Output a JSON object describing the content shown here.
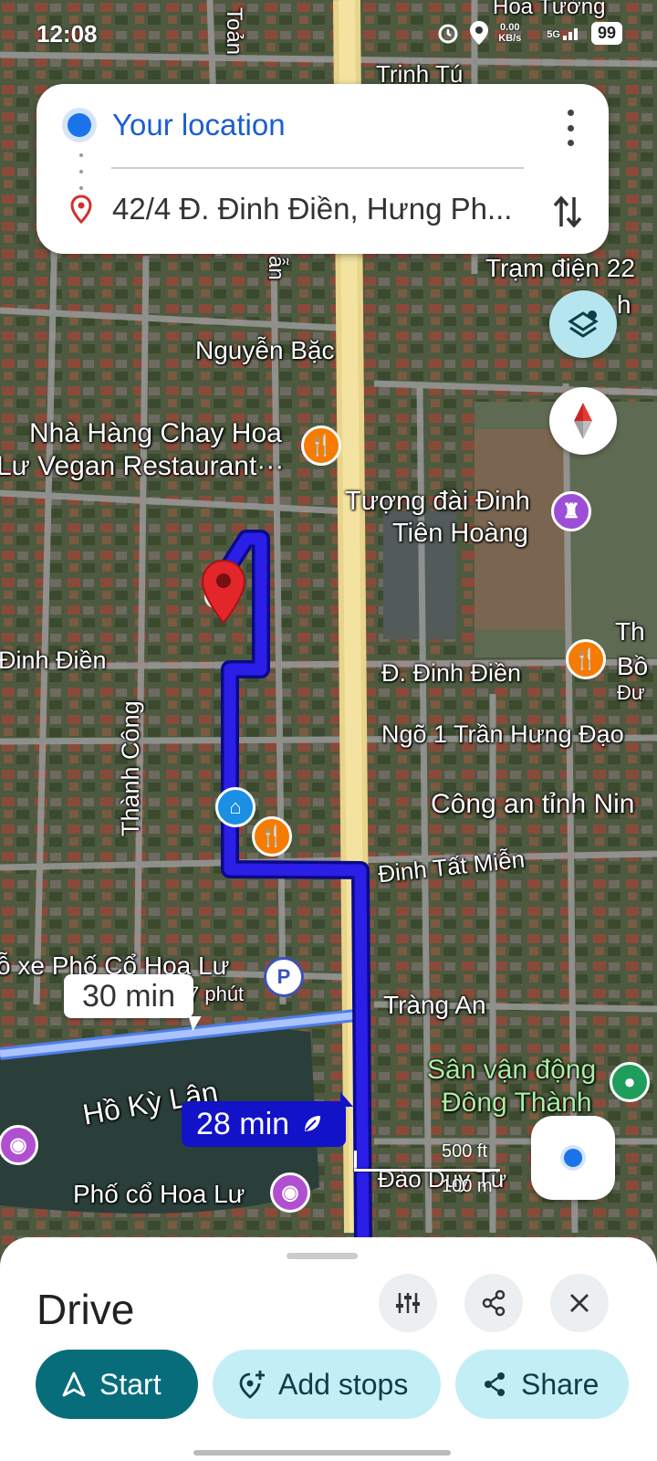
{
  "status_bar": {
    "time": "12:08",
    "network_speed": "0.00\nKB/s",
    "network_type": "5G",
    "battery": "99"
  },
  "directions": {
    "origin": "Your location",
    "destination": "42/4 Đ. Đinh Điền, Hưng Ph..."
  },
  "map": {
    "labels": {
      "trinh_tu": "Trịnh Tú",
      "toan": "Toản",
      "an": "ẫn",
      "tram_dien": "Trạm điện 22",
      "tram_dien_2": "h",
      "nguyen_bac": "Nguyễn Bặc",
      "restaurant_1": "Nhà Hàng Chay Hoa",
      "restaurant_2": "Lư Vegan Restaurant···",
      "statue_1": "Tượng đài Đinh",
      "statue_2": "Tiên Hoàng",
      "dinh_dien_left": "Đinh Điền",
      "dinh_dien_right": "Đ. Đinh Điền",
      "thanh_cong": "Thành Công",
      "ngo_1": "Ngõ 1 Trần Hưng Đạo",
      "cong_an": "Công an tỉnh Nin",
      "dinh_tat_mien": "Đinh Tất Miễn",
      "pho_xe": "ỗ xe Phố Cổ Hoa Lư",
      "bay_phut": "7 phút",
      "trang_an": "Tràng An",
      "san_van_dong_1": "Sân vận động",
      "san_van_dong_2": "Đông Thành",
      "ho_ky_lan": "Hồ Kỳ Lân",
      "dao_duy_tu": "Đào Duy Từ",
      "pho_co": "Phố cổ Hoa Lư",
      "right_edge_1": "Th",
      "right_edge_2": "Bồ",
      "right_edge_3": "Đư",
      "top_right": "Hoa Tường"
    },
    "alt_route_time": "30 min",
    "main_route_time": "28 min",
    "scale_ft": "500 ft",
    "scale_m": "100 m"
  },
  "sheet": {
    "title": "Drive",
    "start": "Start",
    "add_stops": "Add stops",
    "share": "Share"
  },
  "colors": {
    "route": "#2b1ee6",
    "route_outline": "#0a0a8a",
    "alt_route": "#9bb7ff",
    "accent_teal": "#086d7b",
    "pill_light": "#c4eef6",
    "road_major": "#f4e3a0"
  }
}
